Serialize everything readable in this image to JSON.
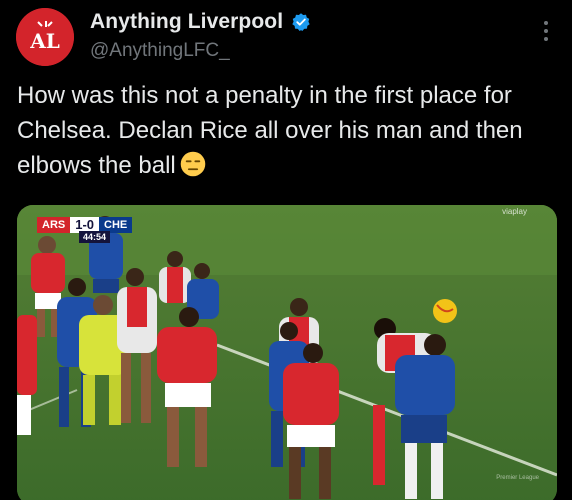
{
  "author": {
    "display_name": "Anything Liverpool",
    "handle": "@AnythingLFC_",
    "avatar_text": "AL",
    "verified": true
  },
  "tweet": {
    "text": "How was this not a penalty in the first place for Chelsea. Declan Rice all over his man and then elbows the ball",
    "emoji": "expressionless-face"
  },
  "media": {
    "scorebug": {
      "home": "ARS",
      "score": "1-0",
      "away": "CHE",
      "clock": "44:54"
    },
    "broadcaster": "viaplay",
    "watermark": "Premier League"
  },
  "icons": {
    "verified": "verified-badge-icon",
    "more": "more-options-icon"
  },
  "colors": {
    "background": "#000000",
    "text_primary": "#e7e9ea",
    "text_secondary": "#71767b",
    "verified_blue": "#1d9bf0",
    "avatar_red": "#d3242b",
    "pitch_green": "#3f6f2c"
  }
}
